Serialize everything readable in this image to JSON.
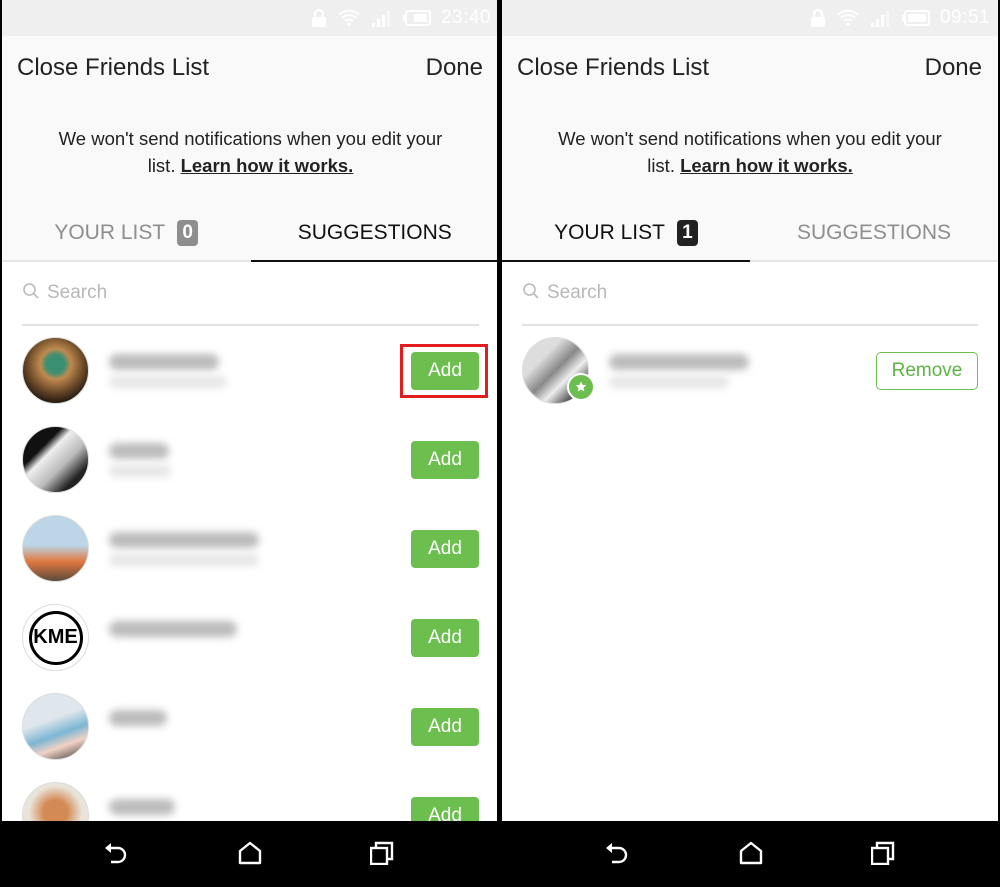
{
  "left_screen": {
    "status_bar": {
      "time": "23:40",
      "icons": [
        "lock-icon",
        "wifi-icon",
        "signal-icon",
        "battery-icon"
      ]
    },
    "header": {
      "title": "Close Friends List",
      "done_label": "Done",
      "notice_text": "We won't send notifications when you edit your list.",
      "notice_line1": "We won't send notifications when you edit your",
      "notice_line2_prefix": "list.",
      "learn_link": "Learn how it works."
    },
    "tabs": [
      {
        "label": "YOUR LIST",
        "badge": "0",
        "active": false
      },
      {
        "label": "SUGGESTIONS",
        "active": true
      }
    ],
    "search": {
      "placeholder": "Search",
      "value": ""
    },
    "suggestions": [
      {
        "avatar": "woman-green-dress",
        "name": "(blurred)",
        "button": "Add",
        "highlighted": true
      },
      {
        "avatar": "bw-sweater",
        "name": "(blurred)",
        "button": "Add",
        "highlighted": false
      },
      {
        "avatar": "man-with-dog",
        "name": "(blurred)",
        "button": "Add",
        "highlighted": false
      },
      {
        "avatar": "kme-logo",
        "name": "(blurred)",
        "button": "Add",
        "highlighted": false
      },
      {
        "avatar": "hands-with-book",
        "name": "(blurred)",
        "button": "Add",
        "highlighted": false
      },
      {
        "avatar": "red-haired-woman",
        "name": "(blurred)",
        "button": "Add",
        "highlighted": false
      }
    ]
  },
  "right_screen": {
    "status_bar": {
      "time": "09:51",
      "icons": [
        "lock-icon",
        "wifi-icon",
        "signal-icon",
        "battery-icon"
      ]
    },
    "header": {
      "title": "Close Friends List",
      "done_label": "Done",
      "notice_line1": "We won't send notifications when you edit your",
      "notice_line2_prefix": "list.",
      "learn_link": "Learn how it works."
    },
    "tabs": [
      {
        "label": "YOUR LIST",
        "badge": "1",
        "active": true
      },
      {
        "label": "SUGGESTIONS",
        "active": false
      }
    ],
    "search": {
      "placeholder": "Search",
      "value": ""
    },
    "list": [
      {
        "avatar": "bw-person",
        "name": "(blurred)",
        "button": "Remove",
        "close_friend_star": true
      }
    ]
  },
  "nav_bar": {
    "buttons": [
      "back",
      "home",
      "recents"
    ]
  },
  "colors": {
    "accent_green": "#6cbf4f",
    "highlight_red": "#e11d1d",
    "badge_gray": "#8e8e8e",
    "badge_dark": "#222222"
  }
}
